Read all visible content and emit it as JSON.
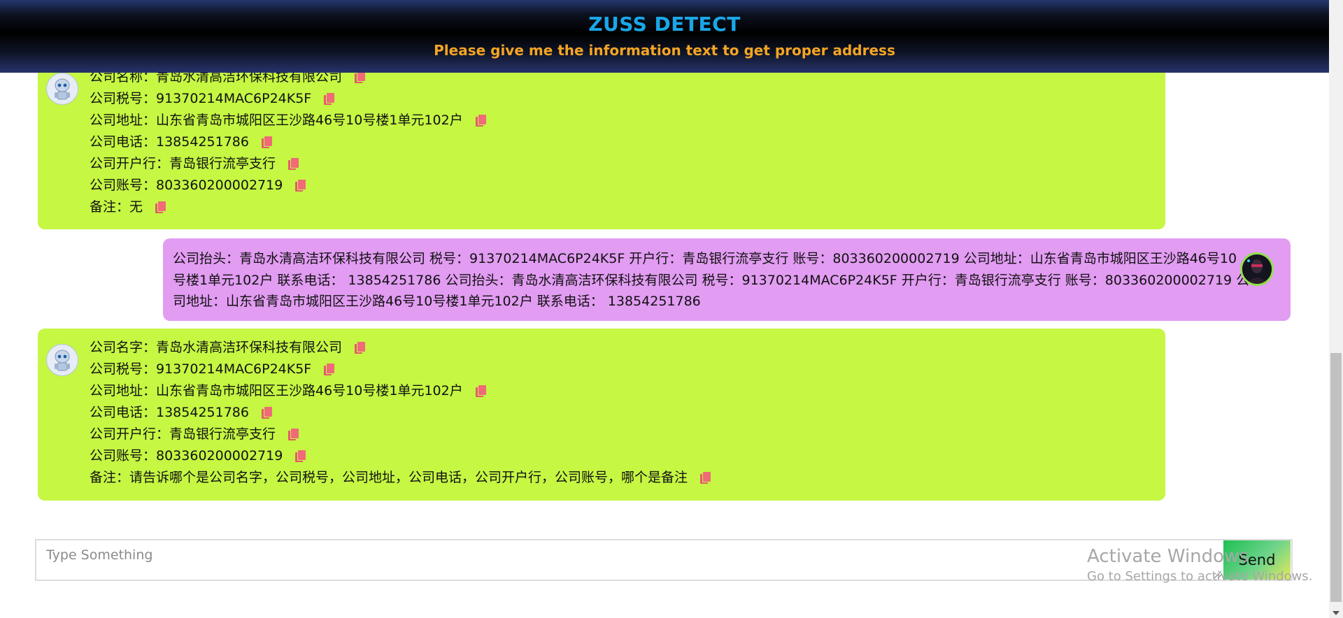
{
  "header": {
    "title": "ZUSS DETECT",
    "subtitle": "Please give me the information text to get proper address"
  },
  "messages": [
    {
      "role": "bot",
      "avatar_icon": "robot-avatar",
      "lines": [
        "公司名称：青岛水清高洁环保科技有限公司",
        "公司税号：91370214MAC6P24K5F",
        "公司地址：山东省青岛市城阳区王沙路46号10号楼1单元102户",
        "公司电话：13854251786",
        "公司开户行：青岛银行流亭支行",
        "公司账号：803360200002719",
        "备注：无"
      ]
    },
    {
      "role": "user",
      "avatar_icon": "user-avatar",
      "text": "公司抬头：青岛水清高洁环保科技有限公司 税号：91370214MAC6P24K5F 开户行：青岛银行流亭支行 账号：803360200002719 公司地址：山东省青岛市城阳区王沙路46号10号楼1单元102户 联系电话： 13854251786 公司抬头：青岛水清高洁环保科技有限公司 税号：91370214MAC6P24K5F 开户行：青岛银行流亭支行 账号：803360200002719 公司地址：山东省青岛市城阳区王沙路46号10号楼1单元102户 联系电话： 13854251786"
    },
    {
      "role": "bot",
      "avatar_icon": "robot-avatar",
      "lines": [
        "公司名字：青岛水清高洁环保科技有限公司",
        "公司税号：91370214MAC6P24K5F",
        "公司地址：山东省青岛市城阳区王沙路46号10号楼1单元102户",
        "公司电话：13854251786",
        "公司开户行：青岛银行流亭支行",
        "公司账号：803360200002719",
        "备注：请告诉哪个是公司名字，公司税号，公司地址，公司电话，公司开户行，公司账号，哪个是备注"
      ]
    }
  ],
  "input": {
    "placeholder": "Type Something",
    "value": ""
  },
  "send_button": {
    "label": "Send"
  },
  "watermark": {
    "line1": "Activate Windows",
    "line2": "Go to Settings to activate Windows."
  },
  "colors": {
    "bot_bubble": "#c5f743",
    "user_bubble": "#e29cf2",
    "title": "#1aa7e8",
    "subtitle": "#f5a524",
    "copy_icon": "#f06a78"
  },
  "icons": {
    "copy": "copy-icon",
    "bot": "robot-icon",
    "user": "user-photo-icon"
  }
}
